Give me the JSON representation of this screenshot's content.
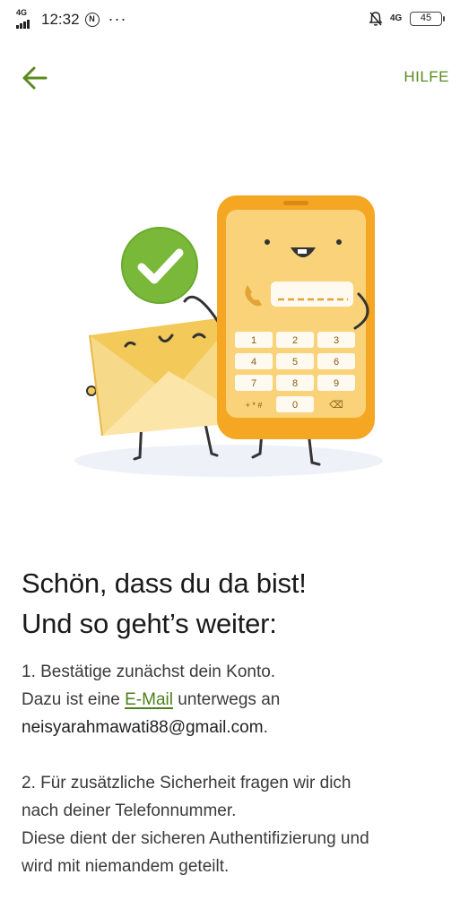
{
  "status_bar": {
    "network_left": "4G",
    "time": "12:32",
    "circle_badge": "N",
    "more_dots": "···",
    "network_right": "4G",
    "battery": "45"
  },
  "header": {
    "back_icon": "arrow-left-icon",
    "help_label": "HILFE",
    "accent_color": "#5a8a1f"
  },
  "illustration": {
    "keypad_keys": [
      "1",
      "2",
      "3",
      "4",
      "5",
      "6",
      "7",
      "8",
      "9",
      "+ * #",
      "0",
      "⌫"
    ],
    "icons": [
      "check-icon",
      "envelope-icon",
      "phone-icon"
    ]
  },
  "main": {
    "headline_line1": "Schön, dass du da bist!",
    "headline_line2": "Und so geht’s weiter:",
    "step1_line1": "1. Bestätige zunächst dein Konto.",
    "step1_line2_pre": "Dazu ist eine ",
    "step1_link": "E-Mail",
    "step1_line2_post": " unterwegs an",
    "step1_email": "neisyarahmawati88@gmail.com",
    "step1_period": ".",
    "step2_line1": "2. Für zusätzliche Sicherheit fragen wir dich",
    "step2_line2": "nach deiner Telefonnummer.",
    "step2_line3": "Diese dient der sicheren Authentifizierung und",
    "step2_line4": "wird mit niemandem geteilt."
  }
}
